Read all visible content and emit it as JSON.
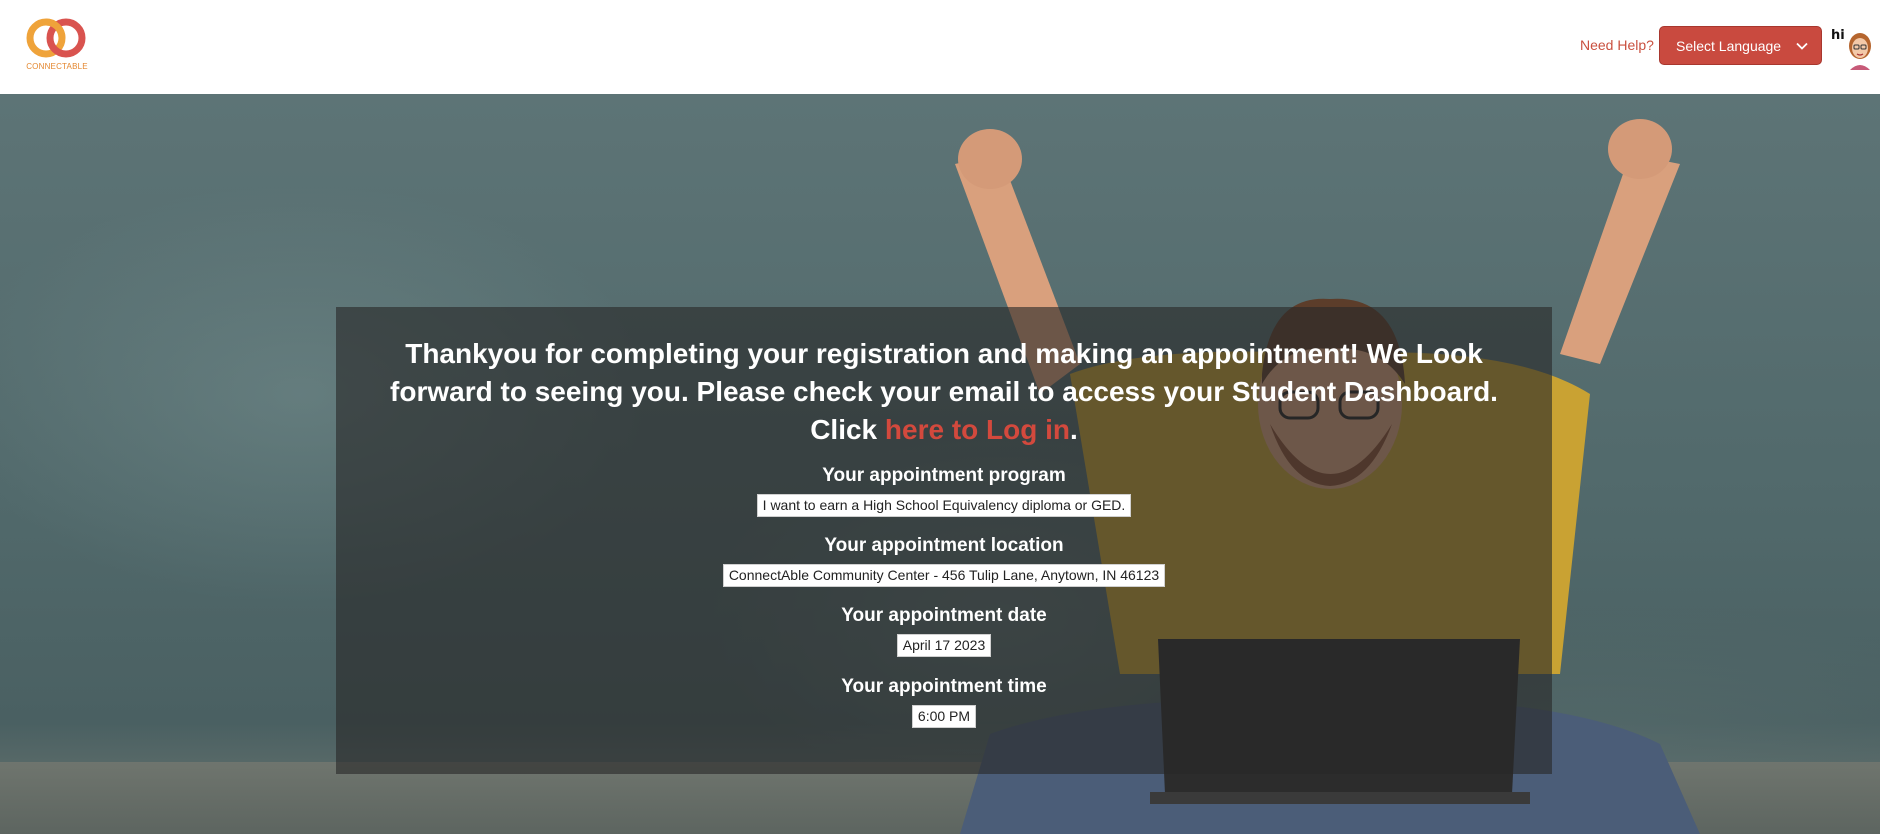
{
  "header": {
    "logo_text": "CONNECTABLE",
    "need_help": "Need Help?",
    "language_button": "Select Language",
    "avatar_greeting": "hi"
  },
  "confirmation": {
    "message_before_link": "Thankyou for completing your registration and making an appointment! We Look forward to seeing you. Please check your email to access your Student Dashboard. Click ",
    "login_link": "here to Log in",
    "message_after_link": ".",
    "fields": [
      {
        "label": "Your appointment program",
        "value": "I want to earn a High School Equivalency diploma or GED."
      },
      {
        "label": "Your appointment location",
        "value": "ConnectAble Community Center - 456 Tulip Lane, Anytown, IN 46123"
      },
      {
        "label": "Your appointment date",
        "value": "April 17 2023"
      },
      {
        "label": "Your appointment time",
        "value": "6:00 PM"
      }
    ]
  },
  "colors": {
    "accent": "#c94a3f",
    "link": "#d3493d",
    "logo_orange": "#e4872f",
    "logo_red": "#d9534f"
  },
  "icons": {
    "logo": "interlocking-rings-logo",
    "language_chevron": "chevron-down-icon",
    "avatar": "bitmoji-avatar"
  }
}
